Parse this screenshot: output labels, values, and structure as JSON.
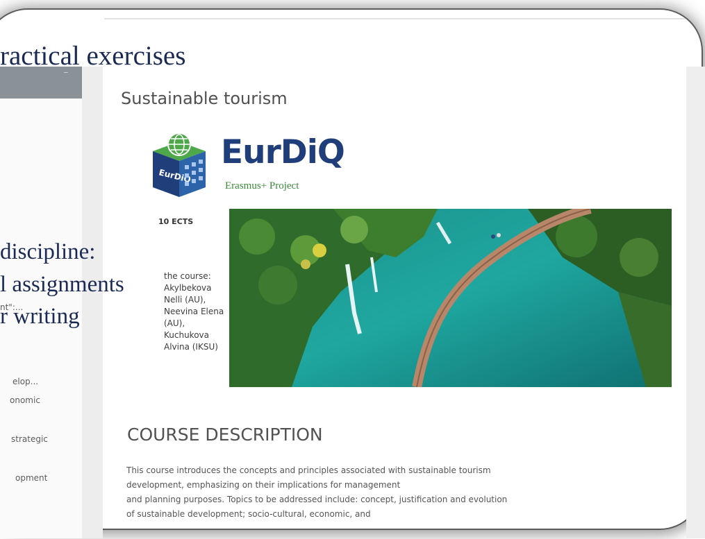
{
  "slide": {
    "title_fragment": "ractical exercises",
    "overlay_line_1": "discipline:",
    "overlay_line_2": "l assignments",
    "overlay_line_3": "r writing"
  },
  "sidebar": {
    "items": [
      {
        "label": "nt\":..."
      },
      {
        "label": "elop..."
      },
      {
        "label": "onomic"
      },
      {
        "label": "strategic"
      },
      {
        "label": "opment"
      }
    ]
  },
  "course": {
    "title": "Sustainable tourism",
    "logo": {
      "name": "EurDiQ",
      "subtitle": "Erasmus+ Project",
      "box_text": "EurDiQ"
    },
    "ects": "10 ECTS",
    "info_lines": [
      "the course:",
      "Akylbekova",
      "Nelli (AU),",
      "Neevina Elena",
      "(AU),",
      "Kuchukova",
      "Alvina (IKSU)"
    ],
    "section_heading": "COURSE DESCRIPTION",
    "description_lines": [
      "This course introduces the concepts and principles associated with sustainable tourism",
      "development, emphasizing on their implications for management",
      " and planning purposes. Topics to be addressed include: concept, justification and evolution",
      "of sustainable development; socio-cultural, economic, and"
    ]
  },
  "colors": {
    "slide_title": "#1b2a55",
    "logo_blue": "#1f3e7a",
    "logo_green": "#4ea84a",
    "sidebar_header": "#8a9298"
  }
}
